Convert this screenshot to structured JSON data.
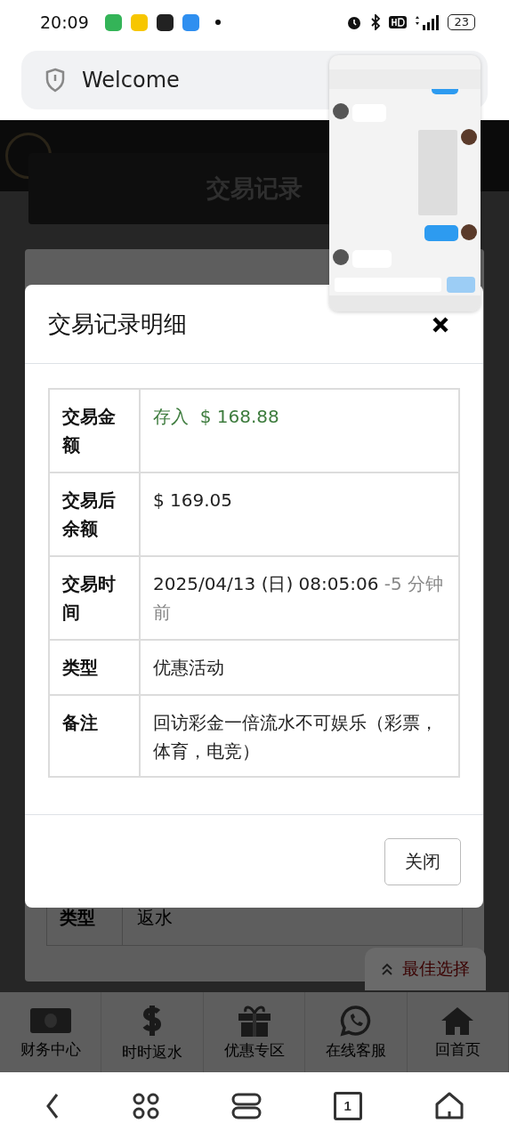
{
  "status_bar": {
    "time": "20:09",
    "battery": "23"
  },
  "address_bar": {
    "title": "Welcome"
  },
  "page": {
    "title": "交易记录",
    "visible_row": {
      "label": "类型",
      "value": "返水"
    },
    "float_button": {
      "label": "最佳选择"
    },
    "nav": [
      {
        "label": "财务中心",
        "kind": "cash"
      },
      {
        "label": "时时返水",
        "kind": "dollar"
      },
      {
        "label": "优惠专区",
        "kind": "gift"
      },
      {
        "label": "在线客服",
        "kind": "chat"
      },
      {
        "label": "回首页",
        "kind": "home"
      }
    ]
  },
  "modal": {
    "title": "交易记录明细",
    "rows": [
      {
        "label": "交易金额",
        "parts": [
          {
            "text": "存入",
            "color": "#3e7c3e"
          },
          {
            "text": "$ 168.88",
            "color": "#3e7c3e"
          }
        ]
      },
      {
        "label": "交易后余额",
        "parts": [
          {
            "text": "$ 169.05",
            "color": "#222222"
          }
        ]
      },
      {
        "label": "交易时间",
        "parts": [
          {
            "text": "2025/04/13 (日) 08:05:06",
            "color": "#222222"
          },
          {
            "text": "-5 分钟前",
            "color": "#888888"
          }
        ]
      },
      {
        "label": "类型",
        "parts": [
          {
            "text": "优惠活动",
            "color": "#222222"
          }
        ]
      },
      {
        "label": "备注",
        "parts": [
          {
            "text": "回访彩金一倍流水不可娱乐（彩票，体育，电竞）",
            "color": "#222222"
          }
        ]
      }
    ],
    "close_button": "关闭"
  },
  "browser_toolbar": {
    "tab_count": "1"
  }
}
